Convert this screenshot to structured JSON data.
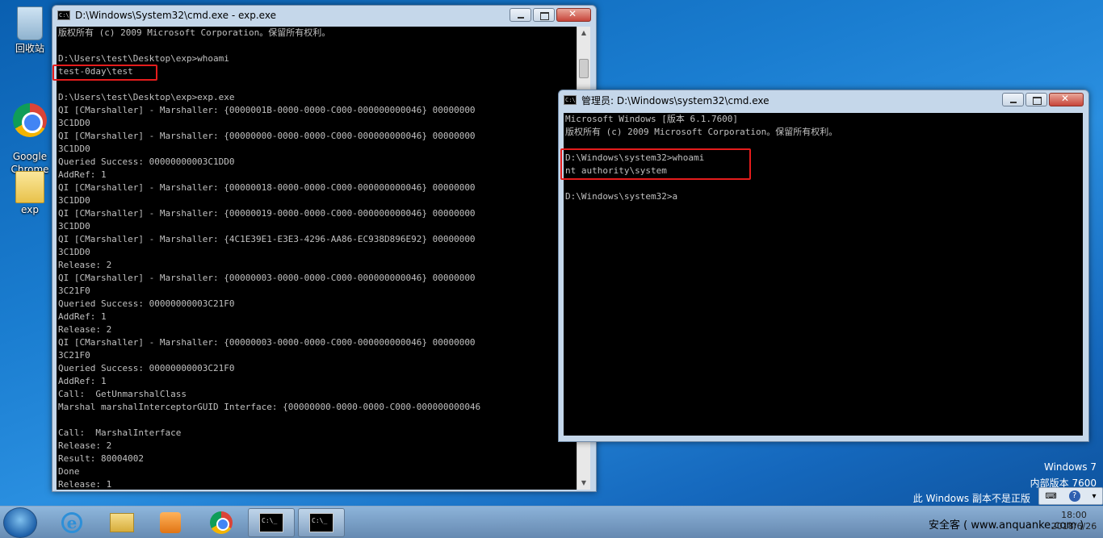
{
  "desktop": {
    "icons": [
      {
        "label": "回收站"
      },
      {
        "label": "Google\nChrome"
      },
      {
        "label": "exp"
      }
    ],
    "watermark": {
      "line1": "Windows 7",
      "line2": "内部版本 7600",
      "line3": "此 Windows 副本不是正版"
    }
  },
  "window1": {
    "title": "D:\\Windows\\System32\\cmd.exe - exp.exe",
    "lines": [
      "版权所有 (c) 2009 Microsoft Corporation。保留所有权利。",
      "",
      "D:\\Users\\test\\Desktop\\exp>whoami",
      "test-0day\\test",
      "",
      "D:\\Users\\test\\Desktop\\exp>exp.exe",
      "QI [CMarshaller] - Marshaller: {0000001B-0000-0000-C000-000000000046} 00000000",
      "3C1DD0",
      "QI [CMarshaller] - Marshaller: {00000000-0000-0000-C000-000000000046} 00000000",
      "3C1DD0",
      "Queried Success: 00000000003C1DD0",
      "AddRef: 1",
      "QI [CMarshaller] - Marshaller: {00000018-0000-0000-C000-000000000046} 00000000",
      "3C1DD0",
      "QI [CMarshaller] - Marshaller: {00000019-0000-0000-C000-000000000046} 00000000",
      "3C1DD0",
      "QI [CMarshaller] - Marshaller: {4C1E39E1-E3E3-4296-AA86-EC938D896E92} 00000000",
      "3C1DD0",
      "Release: 2",
      "QI [CMarshaller] - Marshaller: {00000003-0000-0000-C000-000000000046} 00000000",
      "3C21F0",
      "Queried Success: 00000000003C21F0",
      "AddRef: 1",
      "Release: 2",
      "QI [CMarshaller] - Marshaller: {00000003-0000-0000-C000-000000000046} 00000000",
      "3C21F0",
      "Queried Success: 00000000003C21F0",
      "AddRef: 1",
      "Call:  GetUnmarshalClass",
      "Marshal marshalInterceptorGUID Interface: {00000000-0000-0000-C000-000000000046",
      "",
      "Call:  MarshalInterface",
      "Release: 2",
      "Result: 80004002",
      "Done",
      "Release: 1"
    ]
  },
  "window2": {
    "title": "管理员: D:\\Windows\\system32\\cmd.exe",
    "lines": [
      "Microsoft Windows [版本 6.1.7600]",
      "版权所有 (c) 2009 Microsoft Corporation。保留所有权利。",
      "",
      "D:\\Windows\\system32>whoami",
      "nt authority\\system",
      "",
      "D:\\Windows\\system32>a"
    ]
  },
  "taskbar": {
    "cmd_label": "C:\\_",
    "tray_text": "安全客 ( www.anquanke.com )",
    "time": "18:00",
    "date": "2018/6/26"
  },
  "colors": {
    "highlight": "#e51c1c",
    "console_bg": "#000000",
    "console_fg": "#c0c0c0"
  }
}
